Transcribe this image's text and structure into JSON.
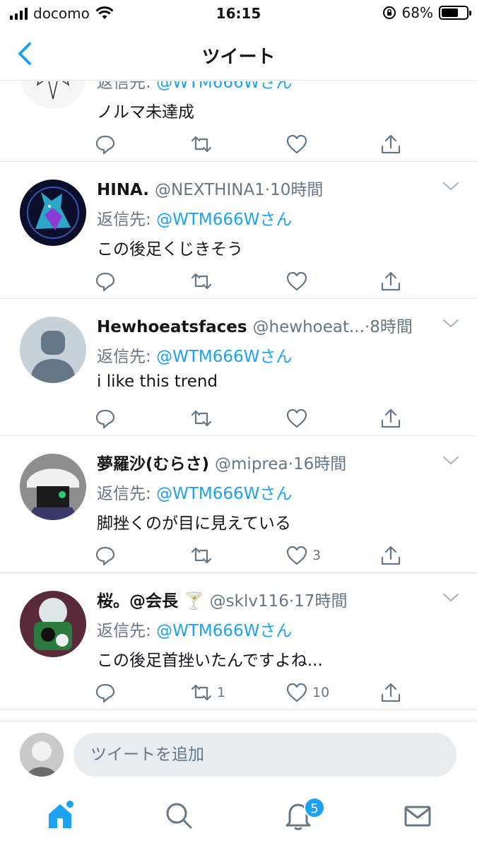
{
  "status_bar": {
    "carrier": "docomo",
    "time": "16:15",
    "battery": "68%",
    "battery_level": 0.68
  },
  "nav": {
    "title": "ツイート"
  },
  "tweets": [
    {
      "name": "",
      "handle": "",
      "time": "",
      "reply_prefix": "返信先: ",
      "reply_to": "@WTM666Wさん",
      "text": "ノルマ未達成",
      "reply_count": "",
      "retweet_count": "",
      "like_count": ""
    },
    {
      "name": "HINA.",
      "handle": "@NEXTHINA1",
      "dot": "·",
      "time": "10時間",
      "reply_prefix": "返信先: ",
      "reply_to": "@WTM666Wさん",
      "text": "この後足くじきそう",
      "reply_count": "",
      "retweet_count": "",
      "like_count": ""
    },
    {
      "name": "Hewhoeatsfaces",
      "handle": "@hewhoeat...",
      "dot": "·",
      "time": "8時間",
      "reply_prefix": "返信先: ",
      "reply_to": "@WTM666Wさん",
      "text": "i like this trend",
      "reply_count": "",
      "retweet_count": "",
      "like_count": ""
    },
    {
      "name": "夢羅沙(むらさ)",
      "handle": "@miprea",
      "dot": "·",
      "time": "16時間",
      "reply_prefix": "返信先: ",
      "reply_to": "@WTM666Wさん",
      "text": "脚挫くのが目に見えている",
      "reply_count": "",
      "retweet_count": "",
      "like_count": "3"
    },
    {
      "name": "桜。@会長",
      "emoji": "🍸",
      "handle": "@sklv116",
      "dot": "·",
      "time": "17時間",
      "reply_prefix": "返信先: ",
      "reply_to": "@WTM666Wさん",
      "text": "この後足首挫いたんですよね...",
      "reply_count": "",
      "retweet_count": "1",
      "like_count": "10"
    }
  ],
  "composer": {
    "placeholder": "ツイートを追加"
  },
  "tab_bar": {
    "notifications_badge": "5"
  },
  "colors": {
    "accent": "#1da1f2",
    "secondary_text": "#657786",
    "divider": "#e1e8ed",
    "input_bg": "#e6ecf0"
  }
}
